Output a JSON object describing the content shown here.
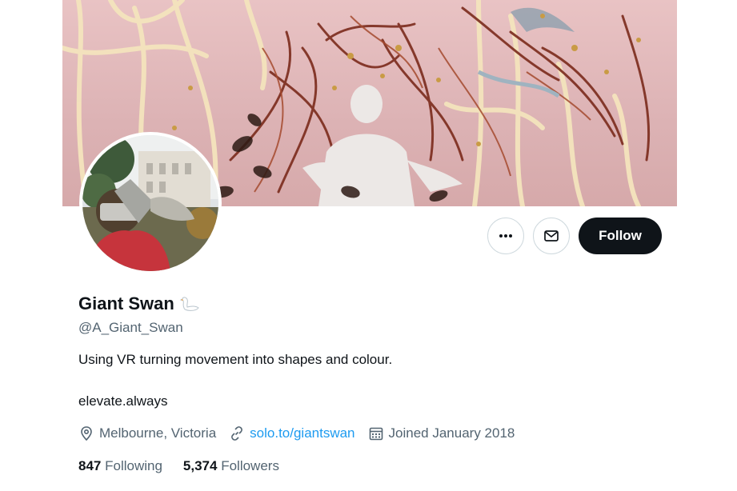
{
  "profile": {
    "display_name": "Giant Swan",
    "handle": "@A_Giant_Swan",
    "bio": "Using VR turning movement into shapes and colour.",
    "tagline": "elevate.always",
    "location": "Melbourne, Victoria",
    "website": "solo.to/giantswan",
    "joined": "Joined January 2018",
    "following_count": "847",
    "following_label": "Following",
    "followers_count": "5,374",
    "followers_label": "Followers"
  },
  "actions": {
    "follow_label": "Follow"
  },
  "icons": {
    "more": "more-horizontal-icon",
    "message": "envelope-icon",
    "location": "location-pin-icon",
    "link": "link-icon",
    "calendar": "calendar-icon",
    "name_emoji": "swan-emoji"
  },
  "colors": {
    "follow_button_bg": "#0f1419",
    "link": "#1d9bf0",
    "secondary_text": "#536471",
    "banner_pink": "#e3bcbd"
  }
}
